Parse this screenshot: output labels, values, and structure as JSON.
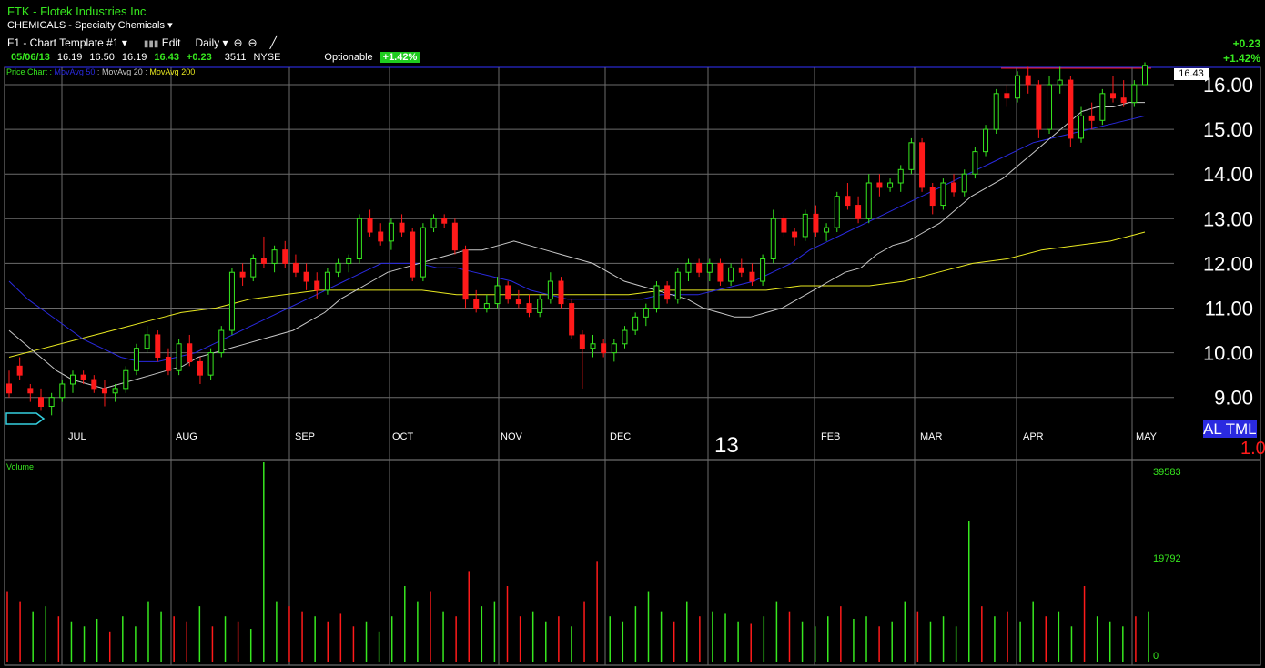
{
  "header": {
    "symbol_line": "FTK - Flotek Industries Inc",
    "sector": "CHEMICALS - Specialty Chemicals",
    "template": "F1 - Chart Template #1",
    "edit_label": "Edit",
    "period": "Daily"
  },
  "quote": {
    "date": "05/06/13",
    "open": "16.19",
    "high": "16.50",
    "low": "16.19",
    "close": "16.43",
    "change": "+0.23",
    "volume": "3511",
    "exchange": "NYSE",
    "optionable": "Optionable",
    "pct_badge": "+1.42%"
  },
  "right_change": {
    "abs": "+0.23",
    "pct": "+1.42%"
  },
  "legend": {
    "price_chart": "Price Chart :",
    "ma50": "MovAvg 50",
    "ma20": "MovAvg 20",
    "ma200": "MovAvg 200"
  },
  "current_price_label": "16.43",
  "al_tml": "AL TML",
  "year_marker": "13",
  "volume_label": "Volume",
  "right_red_value": "1.0",
  "colors": {
    "up": "#37e81f",
    "down": "#ff1a1a",
    "ma50": "#2a2ae0",
    "ma20": "#c8c8c8",
    "ma200": "#e8e820",
    "grid": "#6c6c6c"
  },
  "chart_data": {
    "type": "candlestick",
    "y_ticks": [
      "9.00",
      "10.00",
      "11.00",
      "12.00",
      "13.00",
      "14.00",
      "15.00",
      "16.00"
    ],
    "x_ticks": [
      "JUL",
      "AUG",
      "SEP",
      "OCT",
      "NOV",
      "DEC",
      "FEB",
      "MAR",
      "APR",
      "MAY"
    ],
    "ylim": [
      8.4,
      16.5
    ],
    "volume_ticks": [
      "39583",
      "19792",
      "0"
    ],
    "candles": [
      [
        9.3,
        9.6,
        9.0,
        9.1
      ],
      [
        9.7,
        9.9,
        9.4,
        9.5
      ],
      [
        9.2,
        9.3,
        8.9,
        9.1
      ],
      [
        9.0,
        9.2,
        8.7,
        8.8
      ],
      [
        8.8,
        9.1,
        8.6,
        9.0
      ],
      [
        9.0,
        9.4,
        8.9,
        9.3
      ],
      [
        9.3,
        9.6,
        9.1,
        9.5
      ],
      [
        9.5,
        9.6,
        9.3,
        9.4
      ],
      [
        9.4,
        9.5,
        9.1,
        9.2
      ],
      [
        9.2,
        9.4,
        8.8,
        9.1
      ],
      [
        9.1,
        9.3,
        8.9,
        9.2
      ],
      [
        9.2,
        9.7,
        9.1,
        9.6
      ],
      [
        9.6,
        10.2,
        9.5,
        10.1
      ],
      [
        10.1,
        10.6,
        10.0,
        10.4
      ],
      [
        10.4,
        10.5,
        9.8,
        9.9
      ],
      [
        9.9,
        10.1,
        9.5,
        9.6
      ],
      [
        9.6,
        10.3,
        9.5,
        10.2
      ],
      [
        10.2,
        10.4,
        9.7,
        9.8
      ],
      [
        9.8,
        9.9,
        9.3,
        9.5
      ],
      [
        9.5,
        10.1,
        9.4,
        10.0
      ],
      [
        10.0,
        10.6,
        9.9,
        10.5
      ],
      [
        10.5,
        11.9,
        10.4,
        11.8
      ],
      [
        11.8,
        12.0,
        11.5,
        11.7
      ],
      [
        11.7,
        12.2,
        11.6,
        12.1
      ],
      [
        12.1,
        12.6,
        11.9,
        12.0
      ],
      [
        12.0,
        12.4,
        11.8,
        12.3
      ],
      [
        12.3,
        12.5,
        11.9,
        12.0
      ],
      [
        12.0,
        12.2,
        11.7,
        11.8
      ],
      [
        11.8,
        12.0,
        11.4,
        11.6
      ],
      [
        11.6,
        11.8,
        11.2,
        11.4
      ],
      [
        11.4,
        11.9,
        11.3,
        11.8
      ],
      [
        11.8,
        12.1,
        11.7,
        12.0
      ],
      [
        12.0,
        12.2,
        11.8,
        12.1
      ],
      [
        12.1,
        13.1,
        12.0,
        13.0
      ],
      [
        13.0,
        13.2,
        12.6,
        12.7
      ],
      [
        12.7,
        12.9,
        12.4,
        12.5
      ],
      [
        12.5,
        13.0,
        12.3,
        12.9
      ],
      [
        12.9,
        13.1,
        12.6,
        12.7
      ],
      [
        12.7,
        12.8,
        11.6,
        11.7
      ],
      [
        11.7,
        12.9,
        11.6,
        12.8
      ],
      [
        12.8,
        13.1,
        12.7,
        13.0
      ],
      [
        13.0,
        13.1,
        12.8,
        12.9
      ],
      [
        12.9,
        13.0,
        12.2,
        12.3
      ],
      [
        12.3,
        12.4,
        11.0,
        11.2
      ],
      [
        11.2,
        11.4,
        10.9,
        11.0
      ],
      [
        11.0,
        11.3,
        10.9,
        11.1
      ],
      [
        11.1,
        11.7,
        11.0,
        11.5
      ],
      [
        11.5,
        11.6,
        11.1,
        11.2
      ],
      [
        11.2,
        11.4,
        11.0,
        11.1
      ],
      [
        11.1,
        11.3,
        10.8,
        10.9
      ],
      [
        10.9,
        11.3,
        10.8,
        11.2
      ],
      [
        11.2,
        11.8,
        11.1,
        11.6
      ],
      [
        11.6,
        11.7,
        11.0,
        11.1
      ],
      [
        11.1,
        11.2,
        10.3,
        10.4
      ],
      [
        10.4,
        10.5,
        9.2,
        10.1
      ],
      [
        10.1,
        10.4,
        9.9,
        10.2
      ],
      [
        10.2,
        10.3,
        9.9,
        10.0
      ],
      [
        10.0,
        10.3,
        9.8,
        10.2
      ],
      [
        10.2,
        10.6,
        10.1,
        10.5
      ],
      [
        10.5,
        10.9,
        10.4,
        10.8
      ],
      [
        10.8,
        11.1,
        10.6,
        11.0
      ],
      [
        11.0,
        11.6,
        10.9,
        11.5
      ],
      [
        11.5,
        11.6,
        11.1,
        11.2
      ],
      [
        11.2,
        11.9,
        11.1,
        11.8
      ],
      [
        11.8,
        12.1,
        11.6,
        12.0
      ],
      [
        12.0,
        12.1,
        11.7,
        11.8
      ],
      [
        11.8,
        12.1,
        11.6,
        12.0
      ],
      [
        12.0,
        12.1,
        11.5,
        11.6
      ],
      [
        11.6,
        12.0,
        11.5,
        11.9
      ],
      [
        11.9,
        12.1,
        11.7,
        11.8
      ],
      [
        11.8,
        12.0,
        11.5,
        11.6
      ],
      [
        11.6,
        12.2,
        11.5,
        12.1
      ],
      [
        12.1,
        13.2,
        12.0,
        13.0
      ],
      [
        13.0,
        13.1,
        12.6,
        12.7
      ],
      [
        12.7,
        12.8,
        12.4,
        12.6
      ],
      [
        12.6,
        13.2,
        12.5,
        13.1
      ],
      [
        13.1,
        13.3,
        12.6,
        12.7
      ],
      [
        12.7,
        12.9,
        12.5,
        12.8
      ],
      [
        12.8,
        13.6,
        12.7,
        13.5
      ],
      [
        13.5,
        13.8,
        13.2,
        13.3
      ],
      [
        13.3,
        13.5,
        12.9,
        13.0
      ],
      [
        13.0,
        14.0,
        12.9,
        13.8
      ],
      [
        13.8,
        14.0,
        13.5,
        13.7
      ],
      [
        13.7,
        13.9,
        13.6,
        13.8
      ],
      [
        13.8,
        14.2,
        13.6,
        14.1
      ],
      [
        14.1,
        14.8,
        14.0,
        14.7
      ],
      [
        14.7,
        14.8,
        13.6,
        13.7
      ],
      [
        13.7,
        13.8,
        13.1,
        13.3
      ],
      [
        13.3,
        13.9,
        13.2,
        13.8
      ],
      [
        13.8,
        14.0,
        13.5,
        13.6
      ],
      [
        13.6,
        14.1,
        13.5,
        14.0
      ],
      [
        14.0,
        14.6,
        13.9,
        14.5
      ],
      [
        14.5,
        15.1,
        14.4,
        15.0
      ],
      [
        15.0,
        15.9,
        14.9,
        15.8
      ],
      [
        15.8,
        16.0,
        15.5,
        15.7
      ],
      [
        15.7,
        16.3,
        15.6,
        16.2
      ],
      [
        16.2,
        16.4,
        15.8,
        16.0
      ],
      [
        16.0,
        16.1,
        14.8,
        15.0
      ],
      [
        15.0,
        16.2,
        14.9,
        16.0
      ],
      [
        16.0,
        16.4,
        15.8,
        16.1
      ],
      [
        16.1,
        16.2,
        14.6,
        14.8
      ],
      [
        14.8,
        15.5,
        14.7,
        15.3
      ],
      [
        15.3,
        15.6,
        15.0,
        15.2
      ],
      [
        15.2,
        15.9,
        15.1,
        15.8
      ],
      [
        15.8,
        16.2,
        15.6,
        15.7
      ],
      [
        15.7,
        16.1,
        15.5,
        15.6
      ],
      [
        15.6,
        16.1,
        15.5,
        16.0
      ],
      [
        16.0,
        16.5,
        16.19,
        16.43
      ]
    ],
    "ma20": [
      10.5,
      10.2,
      9.9,
      9.6,
      9.4,
      9.3,
      9.2,
      9.3,
      9.4,
      9.5,
      9.6,
      9.7,
      9.9,
      10.0,
      10.1,
      10.2,
      10.3,
      10.4,
      10.5,
      10.7,
      10.9,
      11.2,
      11.4,
      11.6,
      11.8,
      11.9,
      12.0,
      12.1,
      12.2,
      12.3,
      12.3,
      12.4,
      12.5,
      12.4,
      12.3,
      12.2,
      12.1,
      12.0,
      11.8,
      11.6,
      11.5,
      11.4,
      11.3,
      11.2,
      11.0,
      10.9,
      10.8,
      10.8,
      10.9,
      11.0,
      11.2,
      11.4,
      11.6,
      11.8,
      11.9,
      12.2,
      12.4,
      12.5,
      12.7,
      12.9,
      13.2,
      13.5,
      13.7,
      13.9,
      14.2,
      14.5,
      14.8,
      15.1,
      15.4,
      15.5,
      15.5,
      15.6,
      15.6
    ],
    "ma50": [
      11.6,
      11.2,
      10.9,
      10.6,
      10.3,
      10.1,
      9.9,
      9.8,
      9.8,
      9.9,
      10.0,
      10.2,
      10.4,
      10.6,
      10.8,
      11.0,
      11.2,
      11.4,
      11.6,
      11.8,
      12.0,
      12.0,
      12.0,
      11.9,
      11.9,
      11.8,
      11.7,
      11.6,
      11.4,
      11.3,
      11.2,
      11.2,
      11.2,
      11.2,
      11.2,
      11.3,
      11.3,
      11.3,
      11.4,
      11.5,
      11.6,
      11.8,
      12.0,
      12.3,
      12.5,
      12.7,
      12.9,
      13.1,
      13.3,
      13.5,
      13.7,
      13.9,
      14.1,
      14.3,
      14.5,
      14.7,
      14.8,
      14.9,
      15.0,
      15.1,
      15.2,
      15.3
    ],
    "ma200": [
      9.9,
      10.1,
      10.3,
      10.5,
      10.7,
      10.9,
      11.0,
      11.2,
      11.3,
      11.4,
      11.4,
      11.4,
      11.4,
      11.3,
      11.3,
      11.3,
      11.3,
      11.3,
      11.3,
      11.4,
      11.4,
      11.4,
      11.4,
      11.5,
      11.5,
      11.5,
      11.6,
      11.8,
      12.0,
      12.1,
      12.3,
      12.4,
      12.5,
      12.7
    ],
    "volume": [
      [
        14000,
        0
      ],
      [
        12000,
        0
      ],
      [
        10000,
        1
      ],
      [
        11000,
        1
      ],
      [
        9000,
        0
      ],
      [
        8000,
        1
      ],
      [
        7000,
        1
      ],
      [
        8500,
        1
      ],
      [
        6000,
        0
      ],
      [
        9000,
        1
      ],
      [
        7000,
        1
      ],
      [
        12000,
        1
      ],
      [
        10000,
        1
      ],
      [
        9000,
        0
      ],
      [
        8000,
        0
      ],
      [
        11000,
        1
      ],
      [
        7000,
        0
      ],
      [
        9000,
        1
      ],
      [
        8000,
        0
      ],
      [
        6500,
        1
      ],
      [
        39583,
        1
      ],
      [
        12000,
        1
      ],
      [
        11000,
        0
      ],
      [
        10000,
        0
      ],
      [
        9000,
        1
      ],
      [
        8000,
        0
      ],
      [
        9500,
        0
      ],
      [
        7000,
        0
      ],
      [
        8000,
        1
      ],
      [
        6000,
        1
      ],
      [
        9000,
        1
      ],
      [
        15000,
        1
      ],
      [
        12000,
        1
      ],
      [
        14000,
        0
      ],
      [
        10000,
        1
      ],
      [
        9000,
        0
      ],
      [
        18000,
        0
      ],
      [
        11000,
        1
      ],
      [
        12000,
        1
      ],
      [
        15000,
        0
      ],
      [
        9000,
        0
      ],
      [
        10000,
        1
      ],
      [
        8000,
        1
      ],
      [
        9000,
        0
      ],
      [
        7000,
        1
      ],
      [
        12000,
        0
      ],
      [
        20000,
        0
      ],
      [
        9000,
        1
      ],
      [
        8000,
        1
      ],
      [
        11000,
        1
      ],
      [
        14000,
        1
      ],
      [
        10000,
        1
      ],
      [
        8000,
        0
      ],
      [
        12000,
        1
      ],
      [
        9000,
        0
      ],
      [
        10000,
        1
      ],
      [
        9500,
        1
      ],
      [
        8000,
        1
      ],
      [
        7500,
        0
      ],
      [
        9000,
        1
      ],
      [
        12000,
        1
      ],
      [
        10000,
        0
      ],
      [
        8000,
        1
      ],
      [
        7000,
        1
      ],
      [
        9000,
        1
      ],
      [
        11000,
        0
      ],
      [
        8500,
        1
      ],
      [
        9000,
        1
      ],
      [
        7000,
        0
      ],
      [
        8000,
        1
      ],
      [
        12000,
        1
      ],
      [
        10000,
        0
      ],
      [
        8000,
        1
      ],
      [
        9000,
        1
      ],
      [
        7000,
        1
      ],
      [
        28000,
        1
      ],
      [
        11000,
        0
      ],
      [
        9000,
        1
      ],
      [
        10000,
        0
      ],
      [
        8000,
        1
      ],
      [
        12000,
        1
      ],
      [
        9000,
        0
      ],
      [
        10000,
        1
      ],
      [
        7000,
        1
      ],
      [
        15000,
        0
      ],
      [
        9000,
        1
      ],
      [
        8000,
        1
      ],
      [
        7000,
        1
      ],
      [
        9000,
        0
      ],
      [
        10000,
        1
      ]
    ]
  }
}
